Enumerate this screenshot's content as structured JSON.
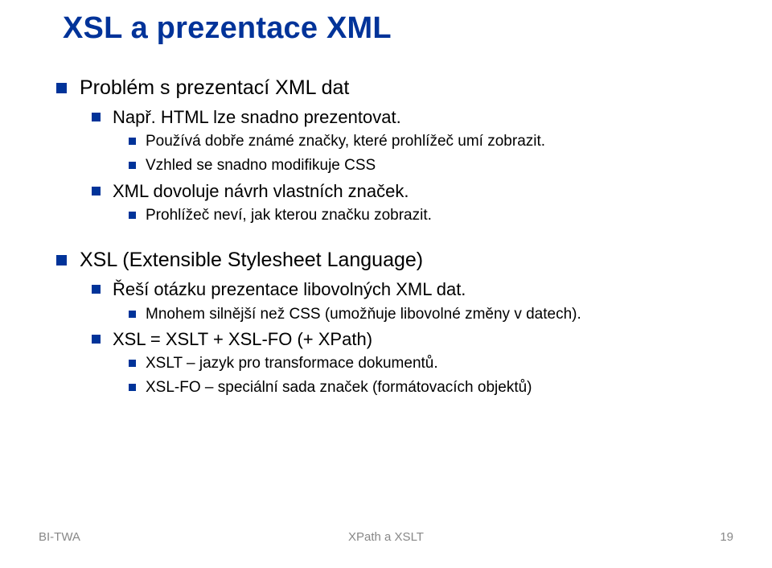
{
  "title": "XSL a prezentace XML",
  "sections": [
    {
      "l1": "Problém s prezentací XML dat",
      "children": [
        {
          "l2": "Např. HTML lze snadno prezentovat.",
          "children": [
            {
              "l3": "Používá dobře známé značky, které prohlížeč umí zobrazit."
            },
            {
              "l3": "Vzhled se snadno modifikuje CSS"
            }
          ]
        },
        {
          "l2": "XML dovoluje návrh vlastních značek.",
          "children": [
            {
              "l3": "Prohlížeč neví, jak kterou značku zobrazit."
            }
          ]
        }
      ]
    },
    {
      "l1": "XSL (Extensible Stylesheet Language)",
      "children": [
        {
          "l2": "Řeší otázku prezentace libovolných XML dat.",
          "children": [
            {
              "l3": "Mnohem silnější než CSS (umožňuje libovolné změny v datech)."
            }
          ]
        },
        {
          "l2": "XSL = XSLT + XSL-FO (+ XPath)",
          "children": [
            {
              "l3": "XSLT – jazyk pro transformace dokumentů."
            },
            {
              "l3": "XSL-FO – speciální sada značek (formátovacích objektů)"
            }
          ]
        }
      ]
    }
  ],
  "footer": {
    "left": "BI-TWA",
    "center": "XPath a XSLT",
    "right": "19"
  }
}
